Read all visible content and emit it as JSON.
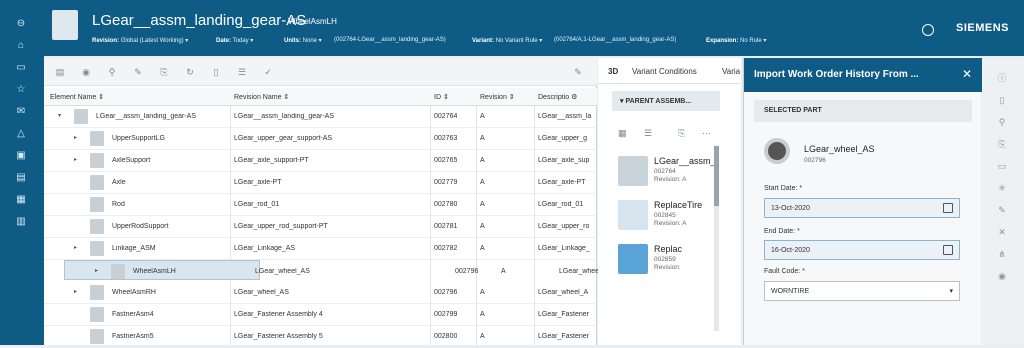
{
  "header": {
    "title": "LGear__assm_landing_gear-AS",
    "subtitle": "WheelAsmLH",
    "revision_label": "Revision:",
    "revision_value": "Global (Latest Working) ▾",
    "date_label": "Date:",
    "date_value": "Today ▾",
    "units_label": "Units:",
    "units_value": "None ▾",
    "path1": "(002764-LGear__assm_landing_gear-AS)",
    "variant_label": "Variant:",
    "variant_value": "No Variant Rule ▾",
    "path2": "(002764/A;1-LGear__assm_landing_gear-AS)",
    "expansion_label": "Expansion:",
    "expansion_value": "No Rule ▾",
    "brand": "SIEMENS"
  },
  "table": {
    "columns": [
      "Element Name",
      "Revision Name",
      "ID",
      "Revision",
      "Descriptio"
    ],
    "rows": [
      {
        "name": "LGear__assm_landing_gear-AS",
        "rev_name": "LGear__assm_landing_gear-AS",
        "id": "002764",
        "rev": "A",
        "desc": "LGear__assm_la",
        "caret": "▾",
        "indent": 0
      },
      {
        "name": "UpperSupportLG",
        "rev_name": "LGear_upper_gear_support-AS",
        "id": "002763",
        "rev": "A",
        "desc": "LGear_upper_g",
        "caret": "▸",
        "indent": 1
      },
      {
        "name": "AxleSupport",
        "rev_name": "LGear_axle_support-PT",
        "id": "002765",
        "rev": "A",
        "desc": "LGear_axle_sup",
        "caret": "▸",
        "indent": 1
      },
      {
        "name": "Axle",
        "rev_name": "LGear_axle-PT",
        "id": "002779",
        "rev": "A",
        "desc": "LGear_axle-PT",
        "caret": "",
        "indent": 1
      },
      {
        "name": "Rod",
        "rev_name": "LGear_rod_01",
        "id": "002780",
        "rev": "A",
        "desc": "LGear_rod_01",
        "caret": "",
        "indent": 1
      },
      {
        "name": "UpperRodSupport",
        "rev_name": "LGear_upper_rod_support-PT",
        "id": "002781",
        "rev": "A",
        "desc": "LGear_upper_ro",
        "caret": "",
        "indent": 1
      },
      {
        "name": "Linkage_ASM",
        "rev_name": "LGear_Linkage_AS",
        "id": "002782",
        "rev": "A",
        "desc": "LGear_Linkage_",
        "caret": "▸",
        "indent": 1
      },
      {
        "name": "WheelAsmLH",
        "rev_name": "LGear_wheel_AS",
        "id": "002796",
        "rev": "A",
        "desc": "LGear_wheel_A",
        "caret": "▸",
        "indent": 1,
        "selected": true
      },
      {
        "name": "WheelAsmRH",
        "rev_name": "LGear_wheel_AS",
        "id": "002796",
        "rev": "A",
        "desc": "LGear_wheel_A",
        "caret": "▸",
        "indent": 1
      },
      {
        "name": "FastnerAsm4",
        "rev_name": "LGear_Fastener Assembly 4",
        "id": "002799",
        "rev": "A",
        "desc": "LGear_Fastener",
        "caret": "",
        "indent": 1
      },
      {
        "name": "FastnerAsm5",
        "rev_name": "LGear_Fastener Assembly 5",
        "id": "002800",
        "rev": "A",
        "desc": "LGear_Fastener",
        "caret": "",
        "indent": 1
      }
    ]
  },
  "mid": {
    "tabs": [
      "3D",
      "Variant Conditions",
      "Varia"
    ],
    "section": "▾  PARENT ASSEMB...",
    "cards": [
      {
        "name": "LGear__assm_",
        "id": "002764",
        "rev": "Revision:  A"
      },
      {
        "name": "ReplaceTire",
        "id": "002845",
        "rev": "Revision:  A"
      },
      {
        "name": "Replac",
        "id": "002859",
        "rev": "Revision:"
      }
    ]
  },
  "panel": {
    "title": "Import Work Order History From ...",
    "section": "SELECTED PART",
    "part_name": "LGear_wheel_AS",
    "part_id": "002796",
    "start_label": "Start Date:  *",
    "start_value": "13-Oct-2020",
    "end_label": "End Date:  *",
    "end_value": "16-Oct-2020",
    "fault_label": "Fault Code:  *",
    "fault_value": "WORNTIRE"
  }
}
